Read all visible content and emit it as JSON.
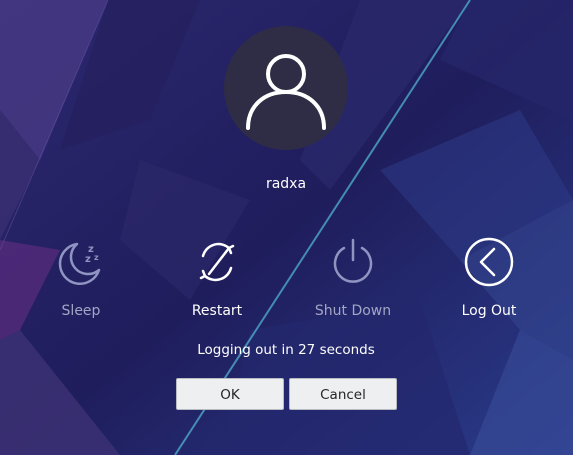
{
  "user": {
    "name": "radxa"
  },
  "actions": [
    {
      "label": "Sleep",
      "icon": "moon-sleep-icon",
      "state": "dim"
    },
    {
      "label": "Restart",
      "icon": "restart-icon",
      "state": "bright"
    },
    {
      "label": "Shut Down",
      "icon": "power-icon",
      "state": "dim"
    },
    {
      "label": "Log Out",
      "icon": "logout-chevron-icon",
      "state": "bright"
    }
  ],
  "countdown": {
    "text": "Logging out in 27 seconds",
    "seconds": 27
  },
  "buttons": {
    "ok_label": "OK",
    "cancel_label": "Cancel"
  },
  "colors": {
    "background": "#1e1d5a",
    "avatar_circle": "#2f2d45",
    "dim_label": "#a3a6c4",
    "button_bg": "#eeeff1"
  }
}
